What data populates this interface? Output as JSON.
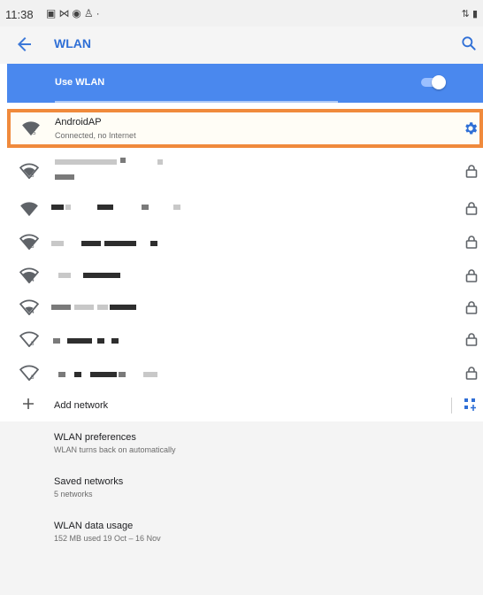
{
  "status_bar": {
    "time": "11:38",
    "icons": [
      "message-icon",
      "mail-icon",
      "assistant-icon",
      "person-icon",
      "dot-icon"
    ],
    "right_icons": [
      "sync-icon",
      "battery-icon"
    ]
  },
  "app_bar": {
    "title": "WLAN"
  },
  "master_switch": {
    "label": "Use WLAN",
    "on": true
  },
  "connected_network": {
    "name": "AndroidAP",
    "status": "Connected, no Internet",
    "band": "5"
  },
  "networks": [
    {
      "name": "",
      "band": "5",
      "locked": true
    },
    {
      "name": "",
      "band": "",
      "locked": true
    },
    {
      "name": "",
      "band": "5",
      "locked": true
    },
    {
      "name": "",
      "band": "4",
      "locked": true
    },
    {
      "name": "",
      "band": "4",
      "locked": true
    },
    {
      "name": "",
      "band": "5",
      "locked": true
    },
    {
      "name": "",
      "band": "5",
      "locked": true
    }
  ],
  "add_network": {
    "label": "Add network"
  },
  "preferences": [
    {
      "title": "WLAN preferences",
      "subtitle": "WLAN turns back on automatically"
    },
    {
      "title": "Saved networks",
      "subtitle": "5 networks"
    },
    {
      "title": "WLAN data usage",
      "subtitle": "152 MB used 19 Oct – 16 Nov"
    }
  ],
  "colors": {
    "accent": "#2f6fd6",
    "master_bar": "#4a88ee",
    "highlight_border": "#f08a3c"
  }
}
